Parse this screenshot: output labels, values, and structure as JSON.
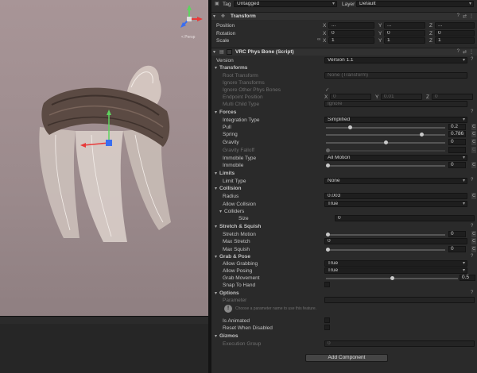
{
  "scene": {
    "gizmo_label": "< Persp"
  },
  "inspector": {
    "header": {
      "tag_label": "Tag",
      "tag_value": "Untagged",
      "layer_label": "Layer",
      "layer_value": "Default"
    },
    "transform": {
      "title": "Transform",
      "position_label": "Position",
      "rotation_label": "Rotation",
      "scale_label": "Scale",
      "position": {
        "x": "...",
        "y": "...",
        "z": "..."
      },
      "rotation": {
        "x": "0",
        "y": "0",
        "z": "0"
      },
      "scale": {
        "x": "1",
        "y": "1",
        "z": "1"
      }
    },
    "physbone": {
      "title": "VRC Phys Bone (Script)",
      "version_label": "Version",
      "version_value": "Version 1.1",
      "transforms": {
        "title": "Transforms",
        "root_transform_label": "Root Transform",
        "root_transform_value": "None (Transform)",
        "ignore_transforms_label": "Ignore Transforms",
        "ignore_other_label": "Ignore Other Phys Bones",
        "endpoint_label": "Endpoint Position",
        "endpoint": {
          "x": "0",
          "y": "0.01",
          "z": "0"
        },
        "multi_child_label": "Multi Child Type",
        "multi_child_value": "Ignore"
      },
      "forces": {
        "title": "Forces",
        "integration_label": "Integration Type",
        "integration_value": "Simplified",
        "pull_label": "Pull",
        "pull_value": "0.2",
        "spring_label": "Spring",
        "spring_value": "0.786",
        "gravity_label": "Gravity",
        "gravity_value": "0",
        "gravity_falloff_label": "Gravity Falloff",
        "immobile_type_label": "Immobile Type",
        "immobile_type_value": "All Motion",
        "immobile_label": "Immobile",
        "immobile_value": "0"
      },
      "limits": {
        "title": "Limits",
        "limit_type_label": "Limit Type",
        "limit_type_value": "None"
      },
      "collision": {
        "title": "Collision",
        "radius_label": "Radius",
        "radius_value": "0.003",
        "allow_collision_label": "Allow Collision",
        "allow_collision_value": "True",
        "colliders_label": "Colliders",
        "size_label": "Size",
        "size_value": "0"
      },
      "stretch": {
        "title": "Stretch & Squish",
        "stretch_motion_label": "Stretch Motion",
        "stretch_motion_value": "0",
        "max_stretch_label": "Max Stretch",
        "max_stretch_value": "0",
        "max_squish_label": "Max Squish",
        "max_squish_value": "0"
      },
      "grab": {
        "title": "Grab & Pose",
        "allow_grabbing_label": "Allow Grabbing",
        "allow_grabbing_value": "True",
        "allow_posing_label": "Allow Posing",
        "allow_posing_value": "True",
        "grab_movement_label": "Grab Movement",
        "grab_movement_value": "0.5",
        "snap_label": "Snap To Hand"
      },
      "options": {
        "title": "Options",
        "parameter_label": "Parameter",
        "info_text": "Choose a parameter name to use this feature.",
        "is_animated_label": "Is Animated",
        "reset_label": "Reset When Disabled"
      },
      "gizmos": {
        "title": "Gizmos",
        "execution_label": "Execution Group",
        "execution_value": "0"
      }
    },
    "add_component_label": "Add Component"
  },
  "colors": {
    "scene_bg": "#9b8a8c",
    "inspector_bg": "#2a2a2a",
    "axis_x": "#e83a3a",
    "axis_y": "#5fd35f",
    "axis_z": "#3a6ef0"
  }
}
